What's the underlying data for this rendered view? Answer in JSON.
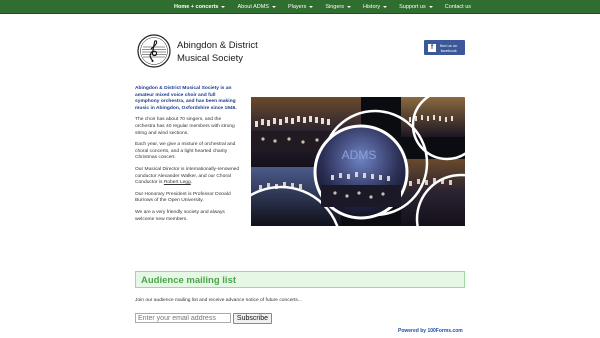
{
  "nav": {
    "items": [
      {
        "label": "Home + concerts",
        "dropdown": true
      },
      {
        "label": "About ADMS",
        "dropdown": true
      },
      {
        "label": "Players",
        "dropdown": true
      },
      {
        "label": "Singers",
        "dropdown": true
      },
      {
        "label": "History",
        "dropdown": true
      },
      {
        "label": "Support us",
        "dropdown": true
      },
      {
        "label": "Contact us",
        "dropdown": false
      }
    ]
  },
  "header": {
    "title_line1": "Abingdon & District",
    "title_line2": "Musical Society"
  },
  "facebook": {
    "line1": "find us on",
    "line2": "facebook"
  },
  "intro": {
    "lead": "Abingdon & District Musical Society is an amateur mixed voice choir and full symphony orchestra, and has been making music in Abingdon, Oxfordshire since 1946.",
    "p2": "The choir has about 70 singers, and the orchestra has 40 regular members with strong string and wind sections.",
    "p3": "Each year, we give a mixture of orchestral and choral concerts, and a light hearted charity Christmas concert.",
    "p4_before": "Our Musical Director is internationally-renowned conductor Alexander Walker, and our Choral Conductor is ",
    "p4_link": "Robert Legg",
    "p4_after": ".",
    "p5": "Our Honorary President is Professor Donald Burrows of the Open University.",
    "p6": "We are a very friendly society and always welcome new members."
  },
  "collage": {
    "center_label": "ADMS"
  },
  "mailing": {
    "heading": "Audience mailing list",
    "text": "Join our audience mailing list and receive advance notice of future concerts...",
    "email_placeholder": "Enter your email address",
    "subscribe_label": "Subscribe",
    "powered_by": "Powered by 100Forms.com"
  },
  "colors": {
    "nav_bg": "#2f6e2f",
    "lead_text": "#1f3b8f",
    "facebook": "#3b5998",
    "mailing_bg": "#e6f7e6",
    "mailing_heading": "#4ca64c"
  }
}
